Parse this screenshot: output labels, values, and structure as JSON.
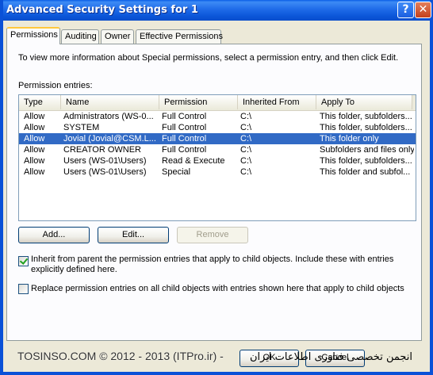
{
  "window": {
    "title": "Advanced Security Settings for 1",
    "help_glyph": "?",
    "close_glyph": "✕"
  },
  "tabs": [
    {
      "label": "Permissions",
      "active": true
    },
    {
      "label": "Auditing",
      "active": false
    },
    {
      "label": "Owner",
      "active": false
    },
    {
      "label": "Effective Permissions",
      "active": false
    }
  ],
  "panel": {
    "intro": "To view more information about Special permissions, select a permission entry, and then click Edit.",
    "entries_label": "Permission entries:"
  },
  "table": {
    "columns": [
      "Type",
      "Name",
      "Permission",
      "Inherited From",
      "Apply To"
    ],
    "rows": [
      {
        "type": "Allow",
        "name": "Administrators (WS-0...",
        "permission": "Full Control",
        "inherited": "C:\\",
        "apply": "This folder, subfolders...",
        "selected": false
      },
      {
        "type": "Allow",
        "name": "SYSTEM",
        "permission": "Full Control",
        "inherited": "C:\\",
        "apply": "This folder, subfolders...",
        "selected": false
      },
      {
        "type": "Allow",
        "name": "Jovial (Jovial@CSM.L...",
        "permission": "Full Control",
        "inherited": "C:\\",
        "apply": "This folder only",
        "selected": true
      },
      {
        "type": "Allow",
        "name": "CREATOR OWNER",
        "permission": "Full Control",
        "inherited": "C:\\",
        "apply": "Subfolders and files only",
        "selected": false
      },
      {
        "type": "Allow",
        "name": "Users (WS-01\\Users)",
        "permission": "Read & Execute",
        "inherited": "C:\\",
        "apply": "This folder, subfolders...",
        "selected": false
      },
      {
        "type": "Allow",
        "name": "Users (WS-01\\Users)",
        "permission": "Special",
        "inherited": "C:\\",
        "apply": "This folder and subfol...",
        "selected": false
      }
    ]
  },
  "buttons": {
    "add": "Add...",
    "edit": "Edit...",
    "remove": "Remove",
    "ok": "OK",
    "cancel": "Cancel"
  },
  "options": {
    "inherit_label": "Inherit from parent the permission entries that apply to child objects. Include these with entries explicitly defined here.",
    "inherit_checked": true,
    "replace_label": "Replace permission entries on all child objects with entries shown here that apply to child objects",
    "replace_checked": false
  },
  "watermark": {
    "text": "TOSINSO.COM © 2012 - 2013 (ITPro.ir) -",
    "rtl_text": "انجمن تخصصی فناوری اطلاعات ایران"
  },
  "colors": {
    "titlebar": "#0a5ee6",
    "selection": "#316ac5",
    "dialog_bg": "#ece9d8"
  }
}
